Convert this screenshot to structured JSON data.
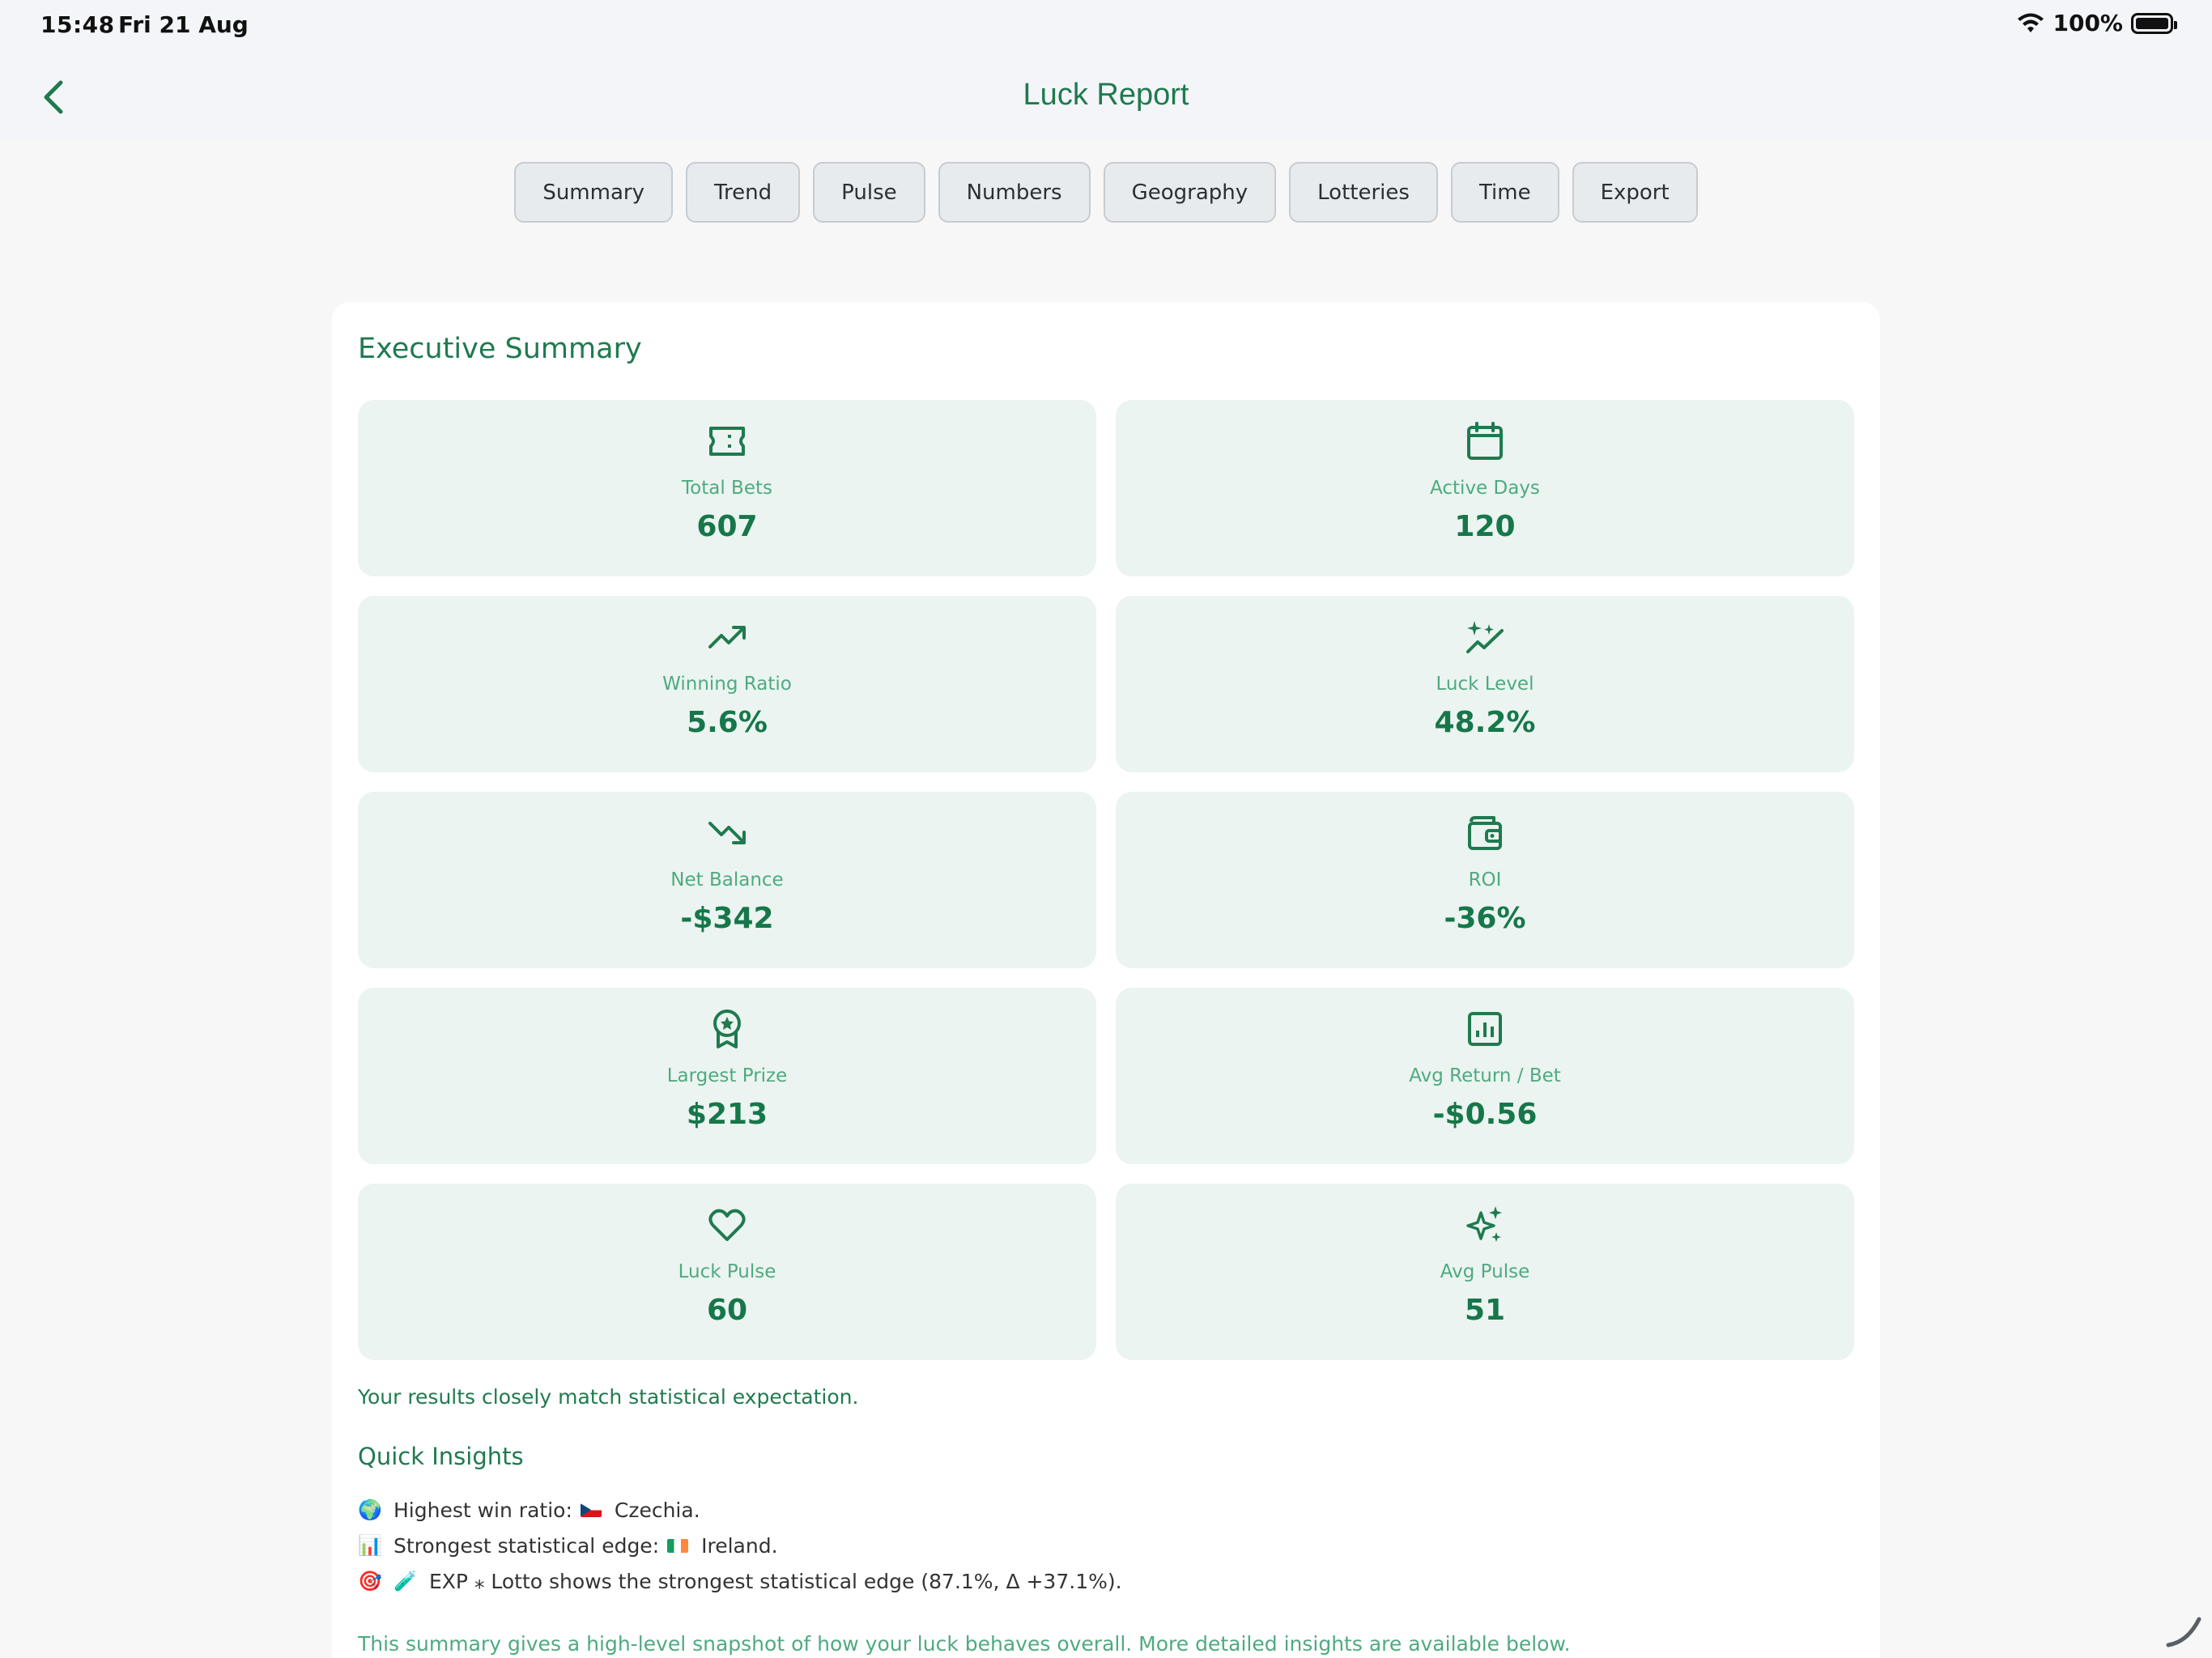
{
  "status_bar": {
    "time": "15:48",
    "date": "Fri 21 Aug",
    "battery": "100%"
  },
  "nav": {
    "title": "Luck Report",
    "back_icon": "chevron-left-icon"
  },
  "tabs": [
    {
      "label": "Summary"
    },
    {
      "label": "Trend"
    },
    {
      "label": "Pulse"
    },
    {
      "label": "Numbers"
    },
    {
      "label": "Geography"
    },
    {
      "label": "Lotteries"
    },
    {
      "label": "Time"
    },
    {
      "label": "Export"
    }
  ],
  "summary": {
    "title": "Executive Summary",
    "tiles": [
      {
        "label": "Total Bets",
        "value": "607",
        "icon": "ticket-icon"
      },
      {
        "label": "Active Days",
        "value": "120",
        "icon": "calendar-icon"
      },
      {
        "label": "Winning Ratio",
        "value": "5.6%",
        "icon": "trend-up-icon"
      },
      {
        "label": "Luck Level",
        "value": "48.2%",
        "icon": "sparkle-chart-icon"
      },
      {
        "label": "Net Balance",
        "value": "-$342",
        "icon": "trend-down-icon"
      },
      {
        "label": "ROI",
        "value": "-36%",
        "icon": "wallet-icon"
      },
      {
        "label": "Largest Prize",
        "value": "$213",
        "icon": "award-icon"
      },
      {
        "label": "Avg Return / Bet",
        "value": "-$0.56",
        "icon": "bar-chart-icon"
      },
      {
        "label": "Luck Pulse",
        "value": "60",
        "icon": "heart-icon"
      },
      {
        "label": "Avg Pulse",
        "value": "51",
        "icon": "sparkles-icon"
      }
    ],
    "note": "Your results closely match statistical expectation."
  },
  "insights": {
    "title": "Quick Insights",
    "items": [
      {
        "emoji": "🌍",
        "prefix": "Highest win ratio:",
        "flag": "cz",
        "suffix": "Czechia."
      },
      {
        "emoji": "📊",
        "prefix": "Strongest statistical edge:",
        "flag": "ie",
        "suffix": "Ireland."
      },
      {
        "emoji": "🎯",
        "emoji2": "🧪",
        "prefix": "",
        "flag": "",
        "suffix": "EXP ⁎ Lotto shows the strongest statistical edge (87.1%, Δ +37.1%)."
      }
    ]
  },
  "footnote": "This summary gives a high-level snapshot of how your luck behaves overall. More detailed insights are available below.",
  "colors": {
    "accent": "#1f7a4f",
    "tile_bg": "#ebf4f0",
    "label": "#4faa80"
  }
}
